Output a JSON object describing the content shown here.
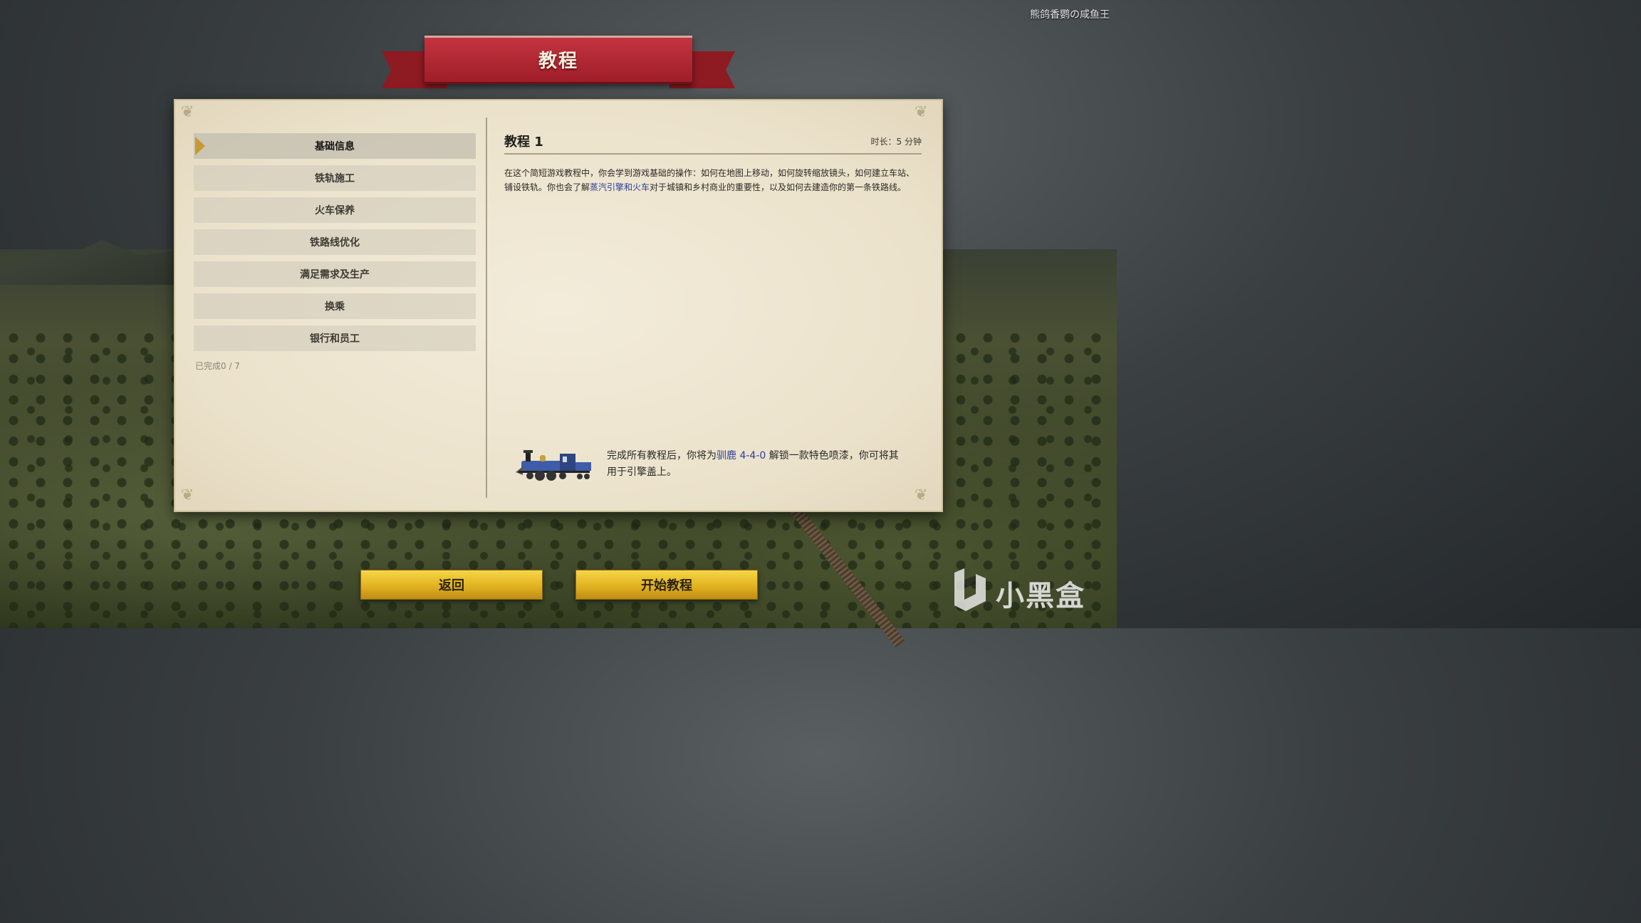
{
  "watermark_top": "熊鸽香鹦の咸鱼王",
  "header": {
    "title": "教程"
  },
  "tutorials": [
    {
      "label": "基础信息",
      "active": true
    },
    {
      "label": "铁轨施工",
      "active": false
    },
    {
      "label": "火车保养",
      "active": false
    },
    {
      "label": "铁路线优化",
      "active": false
    },
    {
      "label": "满足需求及生产",
      "active": false
    },
    {
      "label": "换乘",
      "active": false
    },
    {
      "label": "银行和员工",
      "active": false
    }
  ],
  "progress": "已完成0 / 7",
  "detail": {
    "title": "教程 1",
    "duration": "时长：5 分钟",
    "desc_part1": "在这个简短游戏教程中，你会学到游戏基础的操作：如何在地图上移动，如何旋转缩放镜头，如何建立车站、铺设铁轨。你也会了解",
    "desc_link": "蒸汽引擎和火车",
    "desc_part2": "对于城镇和乡村商业的重要性，以及如何去建造你的第一条铁路线。"
  },
  "reward": {
    "part1": "完成所有教程后，你将为",
    "link": "驯鹿 4-4-0",
    "part2": " 解锁一款特色喷漆，你可将其用于引擎盖上。"
  },
  "buttons": {
    "back": "返回",
    "start": "开始教程"
  },
  "brand": "小黑盒",
  "colors": {
    "ribbon": "#b02a35",
    "button": "#e2b321",
    "link": "#2a3d9c",
    "panel": "#efe7d2"
  }
}
